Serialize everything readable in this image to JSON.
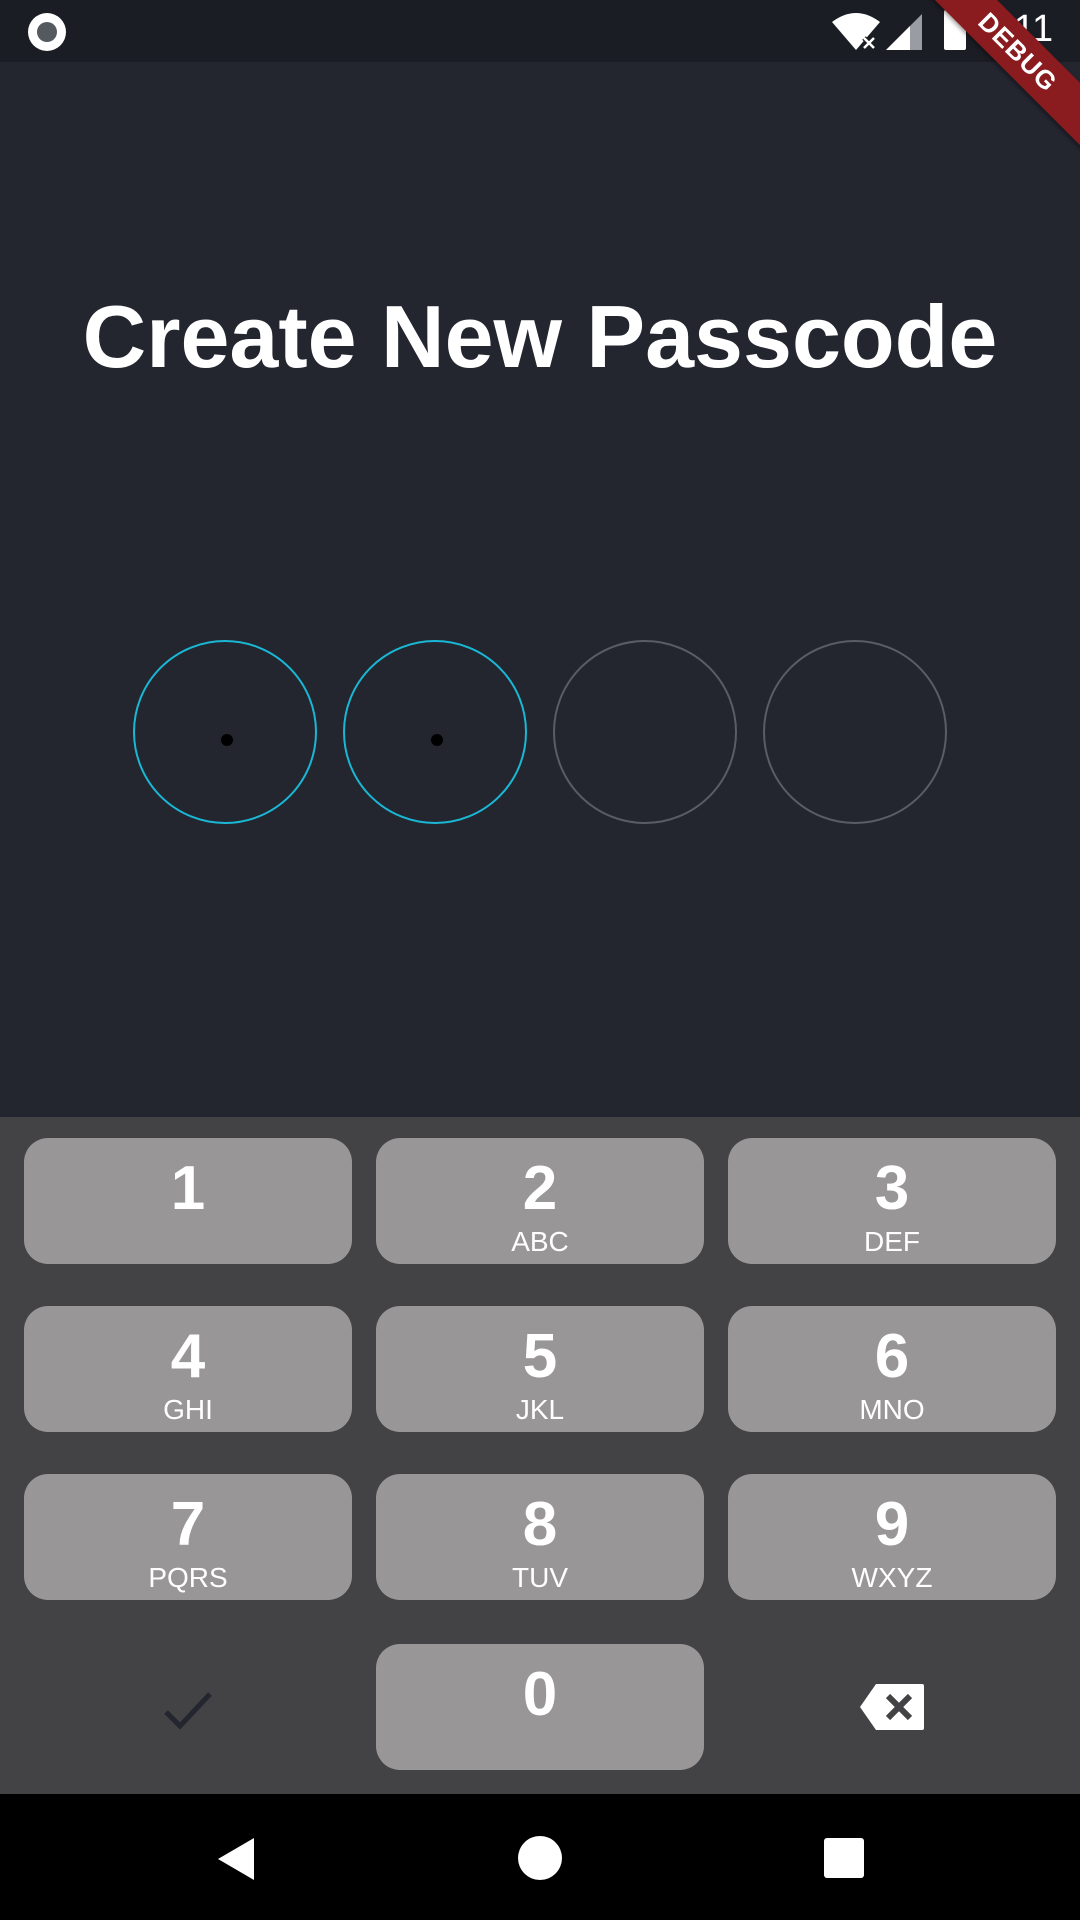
{
  "status_bar": {
    "time": "6:11",
    "icons": [
      "record-icon",
      "wifi-icon",
      "signal-icon",
      "battery-icon"
    ]
  },
  "debug_banner": "DEBUG",
  "title": "Create New Passcode",
  "passcode": {
    "length": 4,
    "entered": 2,
    "accent": "#1ab7d4",
    "empty_border": "#5a5c66"
  },
  "keypad": {
    "keys": [
      {
        "digit": "1",
        "letters": ""
      },
      {
        "digit": "2",
        "letters": "ABC"
      },
      {
        "digit": "3",
        "letters": "DEF"
      },
      {
        "digit": "4",
        "letters": "GHI"
      },
      {
        "digit": "5",
        "letters": "JKL"
      },
      {
        "digit": "6",
        "letters": "MNO"
      },
      {
        "digit": "7",
        "letters": "PQRS"
      },
      {
        "digit": "8",
        "letters": "TUV"
      },
      {
        "digit": "9",
        "letters": "WXYZ"
      },
      {
        "digit": "0",
        "letters": ""
      }
    ],
    "confirm_icon": "check-icon",
    "delete_icon": "backspace-icon"
  },
  "nav_bar": {
    "icons": [
      "back-icon",
      "home-icon",
      "recents-icon"
    ]
  },
  "colors": {
    "background": "#23252f",
    "keypad_bg": "#434244",
    "key_bg": "#999697",
    "debug": "#8a1c1f"
  }
}
